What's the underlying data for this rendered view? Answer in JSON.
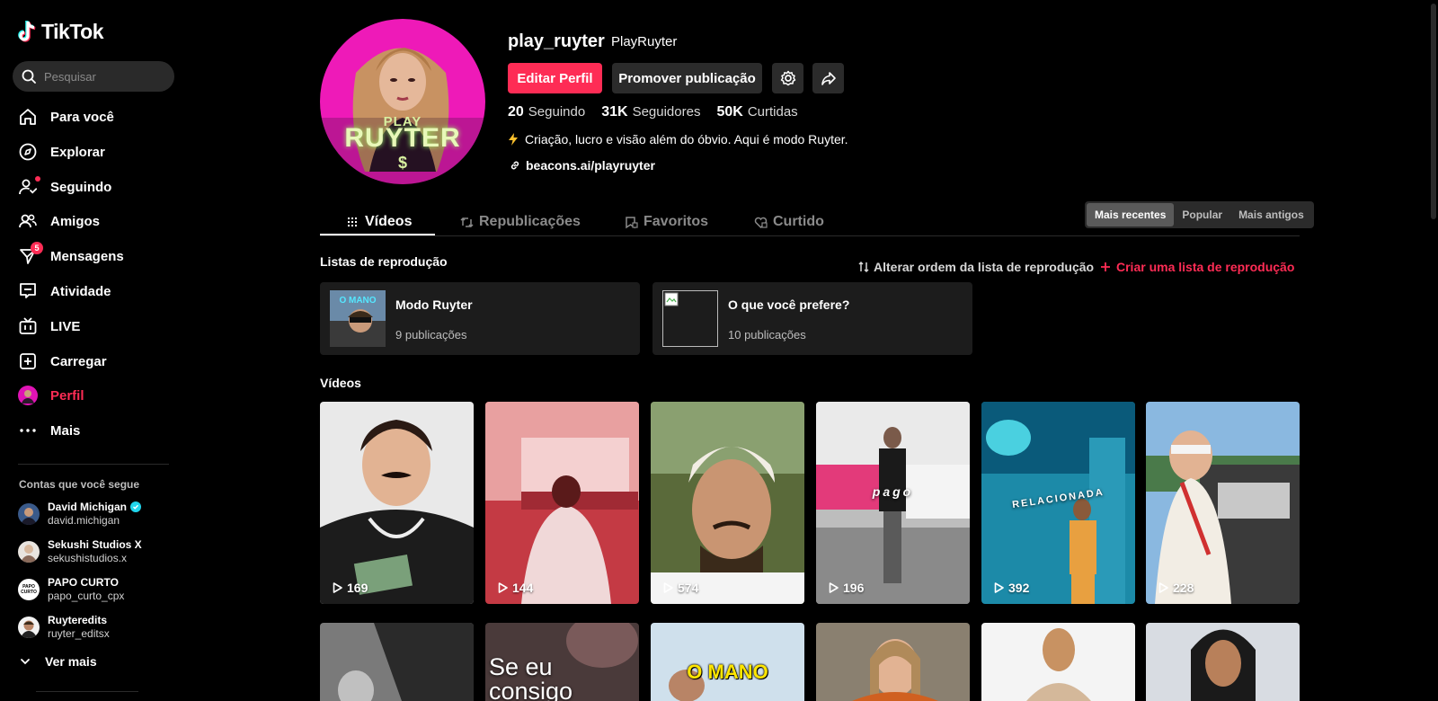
{
  "app": {
    "logo_text": "TikTok"
  },
  "search": {
    "placeholder": "Pesquisar"
  },
  "nav": [
    {
      "label": "Para você",
      "icon": "home-icon"
    },
    {
      "label": "Explorar",
      "icon": "compass-icon"
    },
    {
      "label": "Seguindo",
      "icon": "following-icon"
    },
    {
      "label": "Amigos",
      "icon": "friends-icon"
    },
    {
      "label": "Mensagens",
      "icon": "messages-icon",
      "badge": "5"
    },
    {
      "label": "Atividade",
      "icon": "activity-icon"
    },
    {
      "label": "LIVE",
      "icon": "live-icon"
    },
    {
      "label": "Carregar",
      "icon": "upload-icon"
    },
    {
      "label": "Perfil",
      "icon": "profile-avatar"
    },
    {
      "label": "Mais",
      "icon": "more-icon"
    }
  ],
  "following": {
    "title": "Contas que você segue",
    "accounts": [
      {
        "name": "David Michigan",
        "username": "david.michigan",
        "verified": true
      },
      {
        "name": "Sekushi Studios X",
        "username": "sekushistudios.x"
      },
      {
        "name": "PAPO CURTO",
        "username": "papo_curto_cpx",
        "avatar_text": "PAPO CURTO"
      },
      {
        "name": "Ruyteredits",
        "username": "ruyter_editsx"
      }
    ],
    "see_more": "Ver mais"
  },
  "profile": {
    "username": "play_ruyter",
    "nickname": "PlayRuyter",
    "avatar_text_small": "PLAY",
    "avatar_text_big": "RUYTER",
    "avatar_text_symbol": "$",
    "edit_label": "Editar Perfil",
    "promote_label": "Promover publicação",
    "stats": [
      {
        "num": "20",
        "label": "Seguindo"
      },
      {
        "num": "31K",
        "label": "Seguidores"
      },
      {
        "num": "50K",
        "label": "Curtidas"
      }
    ],
    "bio": "Criação, lucro e visão além do óbvio. Aqui é modo Ruyter.",
    "link": "beacons.ai/playruyter"
  },
  "tabs": [
    {
      "label": "Vídeos",
      "active": true
    },
    {
      "label": "Republicações"
    },
    {
      "label": "Favoritos"
    },
    {
      "label": "Curtido"
    }
  ],
  "sort": [
    "Mais recentes",
    "Popular",
    "Mais antigos"
  ],
  "playlists": {
    "title": "Listas de reprodução",
    "reorder_label": "Alterar ordem da lista de reprodução",
    "create_label": "Criar uma lista de reprodução",
    "items": [
      {
        "title": "Modo Ruyter",
        "count": "9 publicações",
        "thumb_text": "O MANO"
      },
      {
        "title": "O que você prefere?",
        "count": "10 publicações"
      }
    ]
  },
  "videos": {
    "title": "Vídeos",
    "items": [
      {
        "views": "169"
      },
      {
        "views": "144"
      },
      {
        "views": "574"
      },
      {
        "views": "196",
        "overlay": "pago"
      },
      {
        "views": "392",
        "overlay": "RELACIONADA"
      },
      {
        "views": "228"
      },
      {
        "views": ""
      },
      {
        "views": "",
        "overlay": "Se eu consigo"
      },
      {
        "views": "",
        "overlay": "O MANO"
      },
      {
        "views": ""
      },
      {
        "views": ""
      },
      {
        "views": ""
      }
    ]
  },
  "colors": {
    "accent": "#fe2c55",
    "background": "#000000",
    "surface": "#1c1c1c",
    "button": "#2b2b2b"
  }
}
